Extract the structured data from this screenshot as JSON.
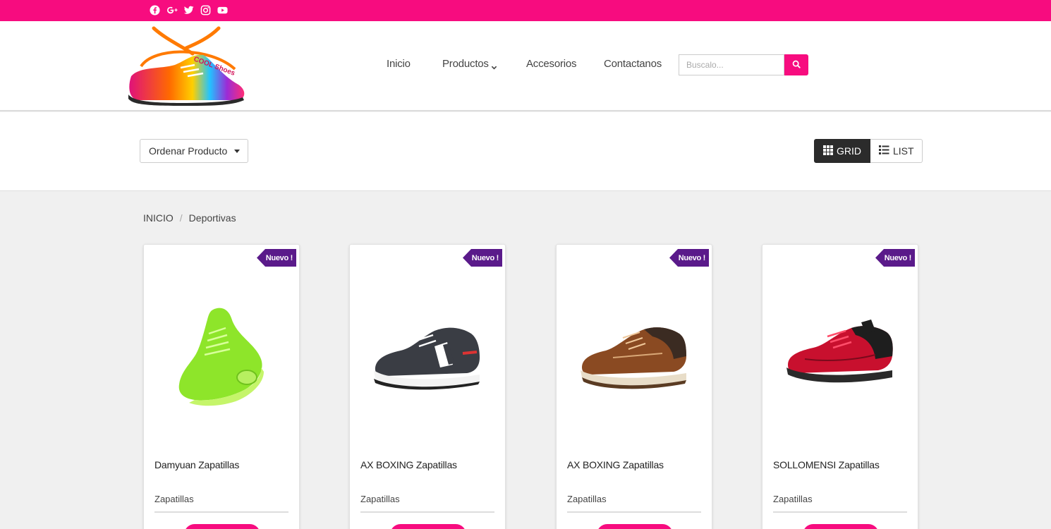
{
  "topbar": {
    "color": "#f70c7f",
    "social_icons": [
      "facebook-icon",
      "google-plus-icon",
      "twitter-icon",
      "instagram-icon",
      "youtube-icon"
    ]
  },
  "header": {
    "logo_text": "COOL Shoes",
    "nav": [
      "Inicio",
      "Productos",
      "Accesorios",
      "Contactanos"
    ],
    "search_placeholder": "Buscalo..."
  },
  "filter": {
    "sort_label": "Ordenar Producto",
    "grid_label": "GRID",
    "list_label": "LIST"
  },
  "breadcrumb": {
    "home": "INICIO",
    "separator": "/",
    "current": "Deportivas"
  },
  "products": [
    {
      "badge": "Nuevo !",
      "name": "Damyuan Zapatillas",
      "category": "Zapatillas",
      "image": "green-sneaker"
    },
    {
      "badge": "Nuevo !",
      "name": "AX BOXING Zapatillas",
      "category": "Zapatillas",
      "image": "grey-sneaker"
    },
    {
      "badge": "Nuevo !",
      "name": "AX BOXING Zapatillas",
      "category": "Zapatillas",
      "image": "brown-sneaker"
    },
    {
      "badge": "Nuevo !",
      "name": "SOLLOMENSI Zapatillas",
      "category": "Zapatillas",
      "image": "red-sneaker"
    }
  ]
}
